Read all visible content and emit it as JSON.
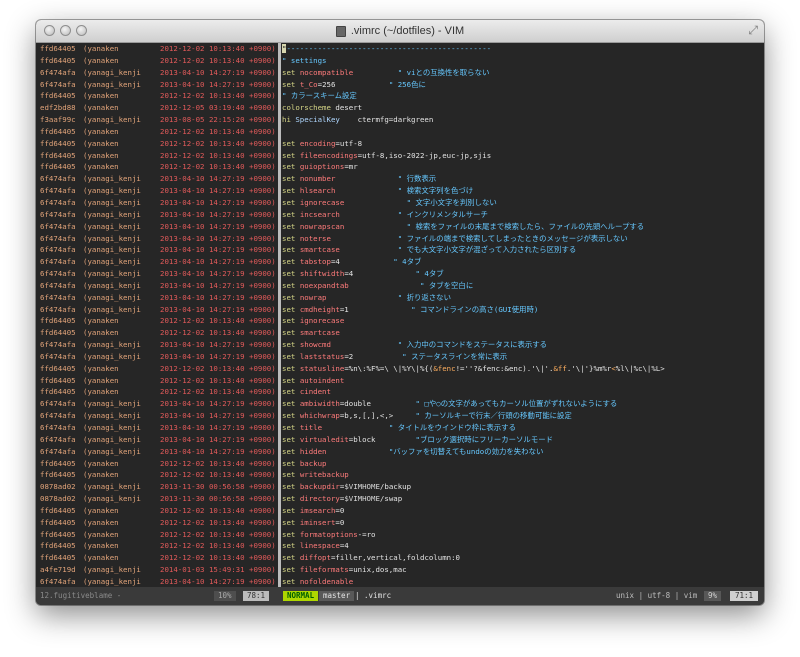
{
  "window": {
    "title": ".vimrc (~/dotfiles) - VIM"
  },
  "icons": {
    "close": "close-light",
    "minimize": "minimize-light",
    "zoom": "zoom-light",
    "doc": "document-icon",
    "resize": "fullscreen-arrows-icon"
  },
  "lines": [
    {
      "hash": "ffd64405",
      "author": "(yanaken",
      "date": "2012-12-02 10:13:40 +0900)",
      "code": [
        {
          "c": "cursor",
          "t": "\""
        },
        {
          "c": "cm",
          "t": "----------------------------------------------"
        }
      ]
    },
    {
      "hash": "ffd64405",
      "author": "(yanaken",
      "date": "2012-12-02 10:13:40 +0900)",
      "code": [
        {
          "c": "cm",
          "t": "\" settings"
        }
      ]
    },
    {
      "hash": "6f474afa",
      "author": "(yanagi_kenji",
      "date": "2013-04-10 14:27:19 +0900)",
      "code": [
        {
          "c": "kw",
          "t": "set "
        },
        {
          "c": "opt",
          "t": "nocompatible"
        },
        {
          "c": "val",
          "t": "          "
        },
        {
          "c": "cm",
          "t": "\" viとの互換性を取らない"
        }
      ]
    },
    {
      "hash": "6f474afa",
      "author": "(yanagi_kenji",
      "date": "2013-04-10 14:27:19 +0900)",
      "code": [
        {
          "c": "kw",
          "t": "set "
        },
        {
          "c": "opt",
          "t": "t_Co"
        },
        {
          "c": "val",
          "t": "=256            "
        },
        {
          "c": "cm",
          "t": "\" 256色に"
        }
      ]
    },
    {
      "hash": "ffd64405",
      "author": "(yanaken",
      "date": "2012-12-02 10:13:40 +0900)",
      "code": [
        {
          "c": "cm",
          "t": "\" カラースキーム設定"
        }
      ]
    },
    {
      "hash": "edf2bd88",
      "author": "(yanaken",
      "date": "2012-12-05 03:19:40 +0900)",
      "code": [
        {
          "c": "kw",
          "t": "colorscheme "
        },
        {
          "c": "val",
          "t": "desert"
        }
      ]
    },
    {
      "hash": "f3aaf99c",
      "author": "(yanagi_kenji",
      "date": "2013-08-05 22:15:20 +0900)",
      "code": [
        {
          "c": "kw",
          "t": "hi "
        },
        {
          "c": "hi",
          "t": "SpecialKey    "
        },
        {
          "c": "val",
          "t": "ctermfg=darkgreen"
        }
      ]
    },
    {
      "hash": "ffd64405",
      "author": "(yanaken",
      "date": "2012-12-02 10:13:40 +0900)",
      "code": []
    },
    {
      "hash": "ffd64405",
      "author": "(yanaken",
      "date": "2012-12-02 10:13:40 +0900)",
      "code": [
        {
          "c": "kw",
          "t": "set "
        },
        {
          "c": "opt",
          "t": "encoding"
        },
        {
          "c": "val",
          "t": "=utf-8"
        }
      ]
    },
    {
      "hash": "ffd64405",
      "author": "(yanaken",
      "date": "2012-12-02 10:13:40 +0900)",
      "code": [
        {
          "c": "kw",
          "t": "set "
        },
        {
          "c": "opt",
          "t": "fileencodings"
        },
        {
          "c": "val",
          "t": "=utf-8,iso-2022-jp,euc-jp,sjis"
        }
      ]
    },
    {
      "hash": "ffd64405",
      "author": "(yanaken",
      "date": "2012-12-02 10:13:40 +0900)",
      "code": [
        {
          "c": "kw",
          "t": "set "
        },
        {
          "c": "opt",
          "t": "guioptions"
        },
        {
          "c": "val",
          "t": "=mr"
        }
      ]
    },
    {
      "hash": "6f474afa",
      "author": "(yanagi_kenji",
      "date": "2013-04-10 14:27:19 +0900)",
      "code": [
        {
          "c": "kw",
          "t": "set "
        },
        {
          "c": "opt",
          "t": "nonumber"
        },
        {
          "c": "val",
          "t": "              "
        },
        {
          "c": "cm",
          "t": "\" 行数表示"
        }
      ]
    },
    {
      "hash": "6f474afa",
      "author": "(yanagi_kenji",
      "date": "2013-04-10 14:27:19 +0900)",
      "code": [
        {
          "c": "kw",
          "t": "set "
        },
        {
          "c": "opt",
          "t": "hlsearch"
        },
        {
          "c": "val",
          "t": "              "
        },
        {
          "c": "cm",
          "t": "\" 検索文字列を色づけ"
        }
      ]
    },
    {
      "hash": "6f474afa",
      "author": "(yanagi_kenji",
      "date": "2013-04-10 14:27:19 +0900)",
      "code": [
        {
          "c": "kw",
          "t": "set "
        },
        {
          "c": "opt",
          "t": "ignorecase"
        },
        {
          "c": "val",
          "t": "              "
        },
        {
          "c": "cm",
          "t": "\" 文字小文字を判別しない"
        }
      ]
    },
    {
      "hash": "6f474afa",
      "author": "(yanagi_kenji",
      "date": "2013-04-10 14:27:19 +0900)",
      "code": [
        {
          "c": "kw",
          "t": "set "
        },
        {
          "c": "opt",
          "t": "incsearch"
        },
        {
          "c": "val",
          "t": "             "
        },
        {
          "c": "cm",
          "t": "\" インクリメンタルサーチ"
        }
      ]
    },
    {
      "hash": "6f474afa",
      "author": "(yanagi_kenji",
      "date": "2013-04-10 14:27:19 +0900)",
      "code": [
        {
          "c": "kw",
          "t": "set "
        },
        {
          "c": "opt",
          "t": "nowrapscan"
        },
        {
          "c": "val",
          "t": "              "
        },
        {
          "c": "cm",
          "t": "\" 検索をファイルの末尾まで検索したら、ファイルの先頭へループする"
        }
      ]
    },
    {
      "hash": "6f474afa",
      "author": "(yanagi_kenji",
      "date": "2013-04-10 14:27:19 +0900)",
      "code": [
        {
          "c": "kw",
          "t": "set "
        },
        {
          "c": "opt",
          "t": "noterse"
        },
        {
          "c": "val",
          "t": "               "
        },
        {
          "c": "cm",
          "t": "\" ファイルの端まで検索してしまったときのメッセージが表示しない"
        }
      ]
    },
    {
      "hash": "6f474afa",
      "author": "(yanagi_kenji",
      "date": "2013-04-10 14:27:19 +0900)",
      "code": [
        {
          "c": "kw",
          "t": "set "
        },
        {
          "c": "opt",
          "t": "smartcase"
        },
        {
          "c": "val",
          "t": "             "
        },
        {
          "c": "cm",
          "t": "\" でも大文字小文字が混ざって入力されたら区別する"
        }
      ]
    },
    {
      "hash": "6f474afa",
      "author": "(yanagi_kenji",
      "date": "2013-04-10 14:27:19 +0900)",
      "code": [
        {
          "c": "kw",
          "t": "set "
        },
        {
          "c": "opt",
          "t": "tabstop"
        },
        {
          "c": "val",
          "t": "=4            "
        },
        {
          "c": "cm",
          "t": "\" 4タブ"
        }
      ]
    },
    {
      "hash": "6f474afa",
      "author": "(yanagi_kenji",
      "date": "2013-04-10 14:27:19 +0900)",
      "code": [
        {
          "c": "kw",
          "t": "set "
        },
        {
          "c": "opt",
          "t": "shiftwidth"
        },
        {
          "c": "val",
          "t": "=4              "
        },
        {
          "c": "cm",
          "t": "\" 4タブ"
        }
      ]
    },
    {
      "hash": "6f474afa",
      "author": "(yanagi_kenji",
      "date": "2013-04-10 14:27:19 +0900)",
      "code": [
        {
          "c": "kw",
          "t": "set "
        },
        {
          "c": "opt",
          "t": "noexpandtab"
        },
        {
          "c": "val",
          "t": "                "
        },
        {
          "c": "cm",
          "t": "\" タブを空白に"
        }
      ]
    },
    {
      "hash": "6f474afa",
      "author": "(yanagi_kenji",
      "date": "2013-04-10 14:27:19 +0900)",
      "code": [
        {
          "c": "kw",
          "t": "set "
        },
        {
          "c": "opt",
          "t": "nowrap"
        },
        {
          "c": "val",
          "t": "                "
        },
        {
          "c": "cm",
          "t": "\" 折り返さない"
        }
      ]
    },
    {
      "hash": "6f474afa",
      "author": "(yanagi_kenji",
      "date": "2013-04-10 14:27:19 +0900)",
      "code": [
        {
          "c": "kw",
          "t": "set "
        },
        {
          "c": "opt",
          "t": "cmdheight"
        },
        {
          "c": "val",
          "t": "=1              "
        },
        {
          "c": "cm",
          "t": "\" コマンドラインの高さ(GUI使用時)"
        }
      ]
    },
    {
      "hash": "ffd64405",
      "author": "(yanaken",
      "date": "2012-12-02 10:13:40 +0900)",
      "code": [
        {
          "c": "kw",
          "t": "set "
        },
        {
          "c": "opt",
          "t": "ignorecase"
        }
      ]
    },
    {
      "hash": "ffd64405",
      "author": "(yanaken",
      "date": "2012-12-02 10:13:40 +0900)",
      "code": [
        {
          "c": "kw",
          "t": "set "
        },
        {
          "c": "opt",
          "t": "smartcase"
        }
      ]
    },
    {
      "hash": "6f474afa",
      "author": "(yanagi_kenji",
      "date": "2013-04-10 14:27:19 +0900)",
      "code": [
        {
          "c": "kw",
          "t": "set "
        },
        {
          "c": "opt",
          "t": "showcmd"
        },
        {
          "c": "val",
          "t": "               "
        },
        {
          "c": "cm",
          "t": "\" 入力中のコマンドをステータスに表示する"
        }
      ]
    },
    {
      "hash": "6f474afa",
      "author": "(yanagi_kenji",
      "date": "2013-04-10 14:27:19 +0900)",
      "code": [
        {
          "c": "kw",
          "t": "set "
        },
        {
          "c": "opt",
          "t": "laststatus"
        },
        {
          "c": "val",
          "t": "=2           "
        },
        {
          "c": "cm",
          "t": "\" ステータスラインを常に表示"
        }
      ]
    },
    {
      "hash": "ffd64405",
      "author": "(yanaken",
      "date": "2012-12-02 10:13:40 +0900)",
      "code": [
        {
          "c": "kw",
          "t": "set "
        },
        {
          "c": "opt",
          "t": "statusline"
        },
        {
          "c": "val",
          "t": "=%n\\:%F%=\\ \\|%Y\\|%{("
        },
        {
          "c": "hl",
          "t": "&fenc"
        },
        {
          "c": "val",
          "t": "!=''?&fenc:&enc).'\\|'."
        },
        {
          "c": "hl",
          "t": "&ff"
        },
        {
          "c": "val",
          "t": ".'\\|'}%m%r"
        },
        {
          "c": "hl",
          "t": "<"
        },
        {
          "c": "val",
          "t": "%l\\|%c\\|%L>"
        }
      ]
    },
    {
      "hash": "ffd64405",
      "author": "(yanaken",
      "date": "2012-12-02 10:13:40 +0900)",
      "code": [
        {
          "c": "kw",
          "t": "set "
        },
        {
          "c": "opt",
          "t": "autoindent"
        }
      ]
    },
    {
      "hash": "ffd64405",
      "author": "(yanaken",
      "date": "2012-12-02 10:13:40 +0900)",
      "code": [
        {
          "c": "kw",
          "t": "set "
        },
        {
          "c": "opt",
          "t": "cindent"
        }
      ]
    },
    {
      "hash": "6f474afa",
      "author": "(yanagi_kenji",
      "date": "2013-04-10 14:27:19 +0900)",
      "code": [
        {
          "c": "kw",
          "t": "set "
        },
        {
          "c": "opt",
          "t": "ambiwidth"
        },
        {
          "c": "val",
          "t": "=double          "
        },
        {
          "c": "cm",
          "t": "\" □や○の文字があってもカーソル位置がずれないようにする"
        }
      ]
    },
    {
      "hash": "6f474afa",
      "author": "(yanagi_kenji",
      "date": "2013-04-10 14:27:19 +0900)",
      "code": [
        {
          "c": "kw",
          "t": "set "
        },
        {
          "c": "opt",
          "t": "whichwrap"
        },
        {
          "c": "val",
          "t": "=b,s,[,],<,>     "
        },
        {
          "c": "cm",
          "t": "\" カーソルキーで行末／行頭の移動可能に設定"
        }
      ]
    },
    {
      "hash": "6f474afa",
      "author": "(yanagi_kenji",
      "date": "2013-04-10 14:27:19 +0900)",
      "code": [
        {
          "c": "kw",
          "t": "set "
        },
        {
          "c": "opt",
          "t": "title"
        },
        {
          "c": "val",
          "t": "               "
        },
        {
          "c": "cm",
          "t": "\" タイトルをウインドウ枠に表示する"
        }
      ]
    },
    {
      "hash": "6f474afa",
      "author": "(yanagi_kenji",
      "date": "2013-04-10 14:27:19 +0900)",
      "code": [
        {
          "c": "kw",
          "t": "set "
        },
        {
          "c": "opt",
          "t": "virtualedit"
        },
        {
          "c": "val",
          "t": "=block         "
        },
        {
          "c": "cm",
          "t": "\"ブロック選択時にフリーカーソルモード"
        }
      ]
    },
    {
      "hash": "6f474afa",
      "author": "(yanagi_kenji",
      "date": "2013-04-10 14:27:19 +0900)",
      "code": [
        {
          "c": "kw",
          "t": "set "
        },
        {
          "c": "opt",
          "t": "hidden"
        },
        {
          "c": "val",
          "t": "              "
        },
        {
          "c": "cm",
          "t": "\"バッファを切替えてもundoの効力を失わない"
        }
      ]
    },
    {
      "hash": "ffd64405",
      "author": "(yanaken",
      "date": "2012-12-02 10:13:40 +0900)",
      "code": [
        {
          "c": "kw",
          "t": "set "
        },
        {
          "c": "opt",
          "t": "backup"
        }
      ]
    },
    {
      "hash": "ffd64405",
      "author": "(yanaken",
      "date": "2012-12-02 10:13:40 +0900)",
      "code": [
        {
          "c": "kw",
          "t": "set "
        },
        {
          "c": "opt",
          "t": "writebackup"
        }
      ]
    },
    {
      "hash": "0878ad02",
      "author": "(yanagi_kenji",
      "date": "2013-11-30 00:56:58 +0900)",
      "code": [
        {
          "c": "kw",
          "t": "set "
        },
        {
          "c": "opt",
          "t": "backupdir"
        },
        {
          "c": "val",
          "t": "="
        },
        {
          "c": "var",
          "t": "$VIMHOME"
        },
        {
          "c": "val",
          "t": "/backup"
        }
      ]
    },
    {
      "hash": "0878ad02",
      "author": "(yanagi_kenji",
      "date": "2013-11-30 00:56:58 +0900)",
      "code": [
        {
          "c": "kw",
          "t": "set "
        },
        {
          "c": "opt",
          "t": "directory"
        },
        {
          "c": "val",
          "t": "="
        },
        {
          "c": "var",
          "t": "$VIMHOME"
        },
        {
          "c": "val",
          "t": "/swap"
        }
      ]
    },
    {
      "hash": "ffd64405",
      "author": "(yanaken",
      "date": "2012-12-02 10:13:40 +0900)",
      "code": [
        {
          "c": "kw",
          "t": "set "
        },
        {
          "c": "opt",
          "t": "imsearch"
        },
        {
          "c": "val",
          "t": "=0"
        }
      ]
    },
    {
      "hash": "ffd64405",
      "author": "(yanaken",
      "date": "2012-12-02 10:13:40 +0900)",
      "code": [
        {
          "c": "kw",
          "t": "set "
        },
        {
          "c": "opt",
          "t": "iminsert"
        },
        {
          "c": "val",
          "t": "=0"
        }
      ]
    },
    {
      "hash": "ffd64405",
      "author": "(yanaken",
      "date": "2012-12-02 10:13:40 +0900)",
      "code": [
        {
          "c": "kw",
          "t": "set "
        },
        {
          "c": "opt",
          "t": "formatoptions"
        },
        {
          "c": "val",
          "t": "-=ro"
        }
      ]
    },
    {
      "hash": "ffd64405",
      "author": "(yanaken",
      "date": "2012-12-02 10:13:40 +0900)",
      "code": [
        {
          "c": "kw",
          "t": "set "
        },
        {
          "c": "opt",
          "t": "linespace"
        },
        {
          "c": "val",
          "t": "=4"
        }
      ]
    },
    {
      "hash": "ffd64405",
      "author": "(yanaken",
      "date": "2012-12-02 10:13:40 +0900)",
      "code": [
        {
          "c": "kw",
          "t": "set "
        },
        {
          "c": "opt",
          "t": "diffopt"
        },
        {
          "c": "val",
          "t": "=filler,vertical,foldcolumn:0"
        }
      ]
    },
    {
      "hash": "a4fe719d",
      "author": "(yanagi_kenji",
      "date": "2014-01-03 15:49:31 +0900)",
      "code": [
        {
          "c": "kw",
          "t": "set "
        },
        {
          "c": "opt",
          "t": "fileformats"
        },
        {
          "c": "val",
          "t": "=unix,dos,mac"
        }
      ]
    },
    {
      "hash": "6f474afa",
      "author": "(yanagi_kenji",
      "date": "2013-04-10 14:27:19 +0900)",
      "code": [
        {
          "c": "kw",
          "t": "set "
        },
        {
          "c": "opt",
          "t": "nofoldenable"
        }
      ]
    },
    {
      "hash": "c5dd58a5",
      "author": "(yanagi_kenji",
      "date": "2013-07-22 14:23:34 +0900)",
      "code": [
        {
          "c": "cm",
          "t": "\"let php_folding=1"
        }
      ]
    },
    {
      "hash": "6f474afa",
      "author": "(yanagi_kenji",
      "date": "2013-04-10 14:27:19 +0900)",
      "code": []
    }
  ],
  "statusbar": {
    "left_name": "12.fugitiveblame -",
    "left_pct": "10%",
    "left_pos": "78:1",
    "mode": "NORMAL",
    "branch": "master",
    "file": "| .vimrc",
    "right_info": "unix | utf-8 | vim",
    "right_pct": "9%",
    "right_pos": "71:1"
  }
}
